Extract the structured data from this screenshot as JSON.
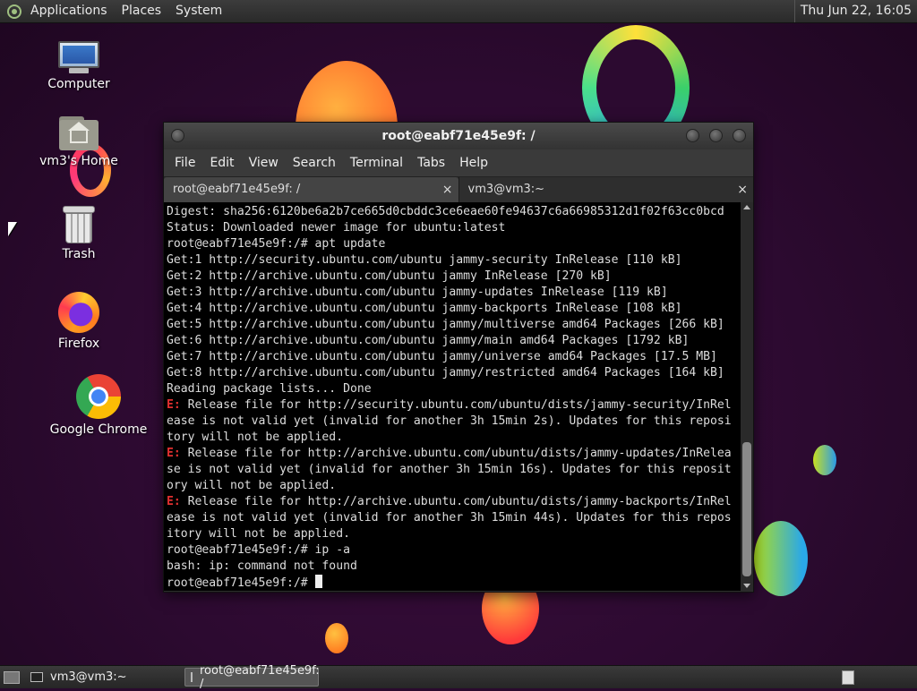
{
  "top_panel": {
    "menus": [
      "Applications",
      "Places",
      "System"
    ],
    "clock": "Thu Jun 22, 16:05"
  },
  "desktop_icons": {
    "computer": "Computer",
    "home": "vm3's Home",
    "trash": "Trash",
    "firefox": "Firefox",
    "chrome": "Google Chrome"
  },
  "terminal": {
    "title": "root@eabf71e45e9f: /",
    "menu": [
      "File",
      "Edit",
      "View",
      "Search",
      "Terminal",
      "Tabs",
      "Help"
    ],
    "tabs": [
      {
        "label": "root@eabf71e45e9f: /",
        "close": "×"
      },
      {
        "label": "vm3@vm3:~",
        "close": "×"
      }
    ],
    "lines": [
      "Digest: sha256:6120be6a2b7ce665d0cbddc3ce6eae60fe94637c6a66985312d1f02f63cc0bcd",
      "Status: Downloaded newer image for ubuntu:latest",
      "root@eabf71e45e9f:/# apt update",
      "Get:1 http://security.ubuntu.com/ubuntu jammy-security InRelease [110 kB]",
      "Get:2 http://archive.ubuntu.com/ubuntu jammy InRelease [270 kB]",
      "Get:3 http://archive.ubuntu.com/ubuntu jammy-updates InRelease [119 kB]",
      "Get:4 http://archive.ubuntu.com/ubuntu jammy-backports InRelease [108 kB]",
      "Get:5 http://archive.ubuntu.com/ubuntu jammy/multiverse amd64 Packages [266 kB]",
      "Get:6 http://archive.ubuntu.com/ubuntu jammy/main amd64 Packages [1792 kB]",
      "Get:7 http://archive.ubuntu.com/ubuntu jammy/universe amd64 Packages [17.5 MB]",
      "Get:8 http://archive.ubuntu.com/ubuntu jammy/restricted amd64 Packages [164 kB]",
      "Reading package lists... Done",
      {
        "err": "E:",
        "text": " Release file for http://security.ubuntu.com/ubuntu/dists/jammy-security/InRel"
      },
      "ease is not valid yet (invalid for another 3h 15min 2s). Updates for this reposi",
      "tory will not be applied.",
      {
        "err": "E:",
        "text": " Release file for http://archive.ubuntu.com/ubuntu/dists/jammy-updates/InRelea"
      },
      "se is not valid yet (invalid for another 3h 15min 16s). Updates for this reposit",
      "ory will not be applied.",
      {
        "err": "E:",
        "text": " Release file for http://archive.ubuntu.com/ubuntu/dists/jammy-backports/InRel"
      },
      "ease is not valid yet (invalid for another 3h 15min 44s). Updates for this repos",
      "itory will not be applied.",
      "root@eabf71e45e9f:/# ip -a",
      "bash: ip: command not found",
      {
        "prompt": "root@eabf71e45e9f:/# "
      }
    ]
  },
  "taskbar": {
    "tasks": [
      "vm3@vm3:~",
      "root@eabf71e45e9f: /"
    ]
  },
  "colors": {
    "error": "#e03030",
    "terminal_bg": "#000000",
    "terminal_fg": "#dddddd"
  }
}
